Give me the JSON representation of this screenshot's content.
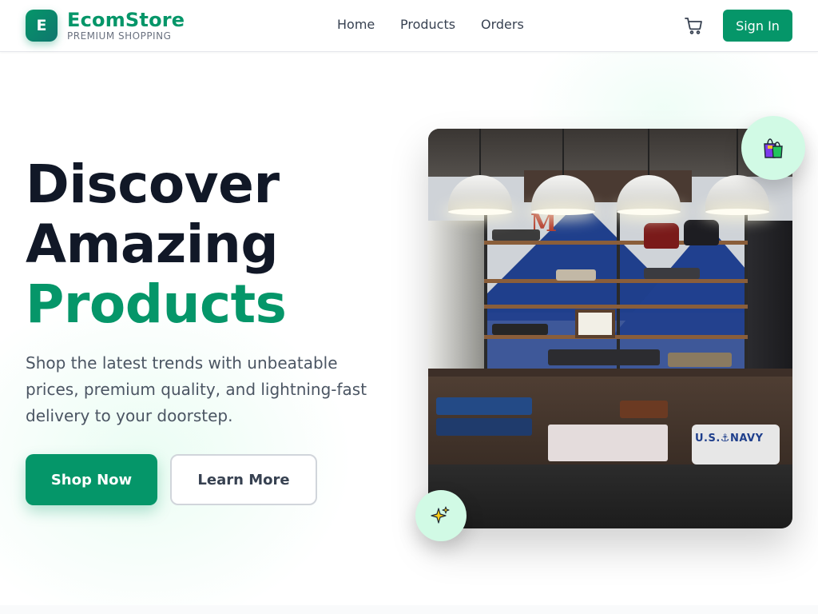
{
  "brand": {
    "initial": "E",
    "name": "EcomStore",
    "tagline": "PREMIUM SHOPPING"
  },
  "nav": {
    "links": [
      "Home",
      "Products",
      "Orders"
    ],
    "cart_icon": "shopping-cart-icon",
    "sign_in_label": "Sign In"
  },
  "hero": {
    "headline_line1": "Discover",
    "headline_line2": "Amazing",
    "headline_accent": "Products",
    "subtitle": "Shop the latest trends with unbeatable prices, premium quality, and lightning-fast delivery to your doorstep.",
    "primary_cta": "Shop Now",
    "secondary_cta": "Learn More",
    "image_signage": "U.S.⚓NAVY",
    "image_letter": "M",
    "badge_top_icon": "shopping-bags-icon",
    "badge_bottom_icon": "sparkles-icon"
  },
  "colors": {
    "accent": "#059669",
    "heading": "#111827",
    "body_text": "#4b5563",
    "badge_bg": "#d1fae5"
  }
}
